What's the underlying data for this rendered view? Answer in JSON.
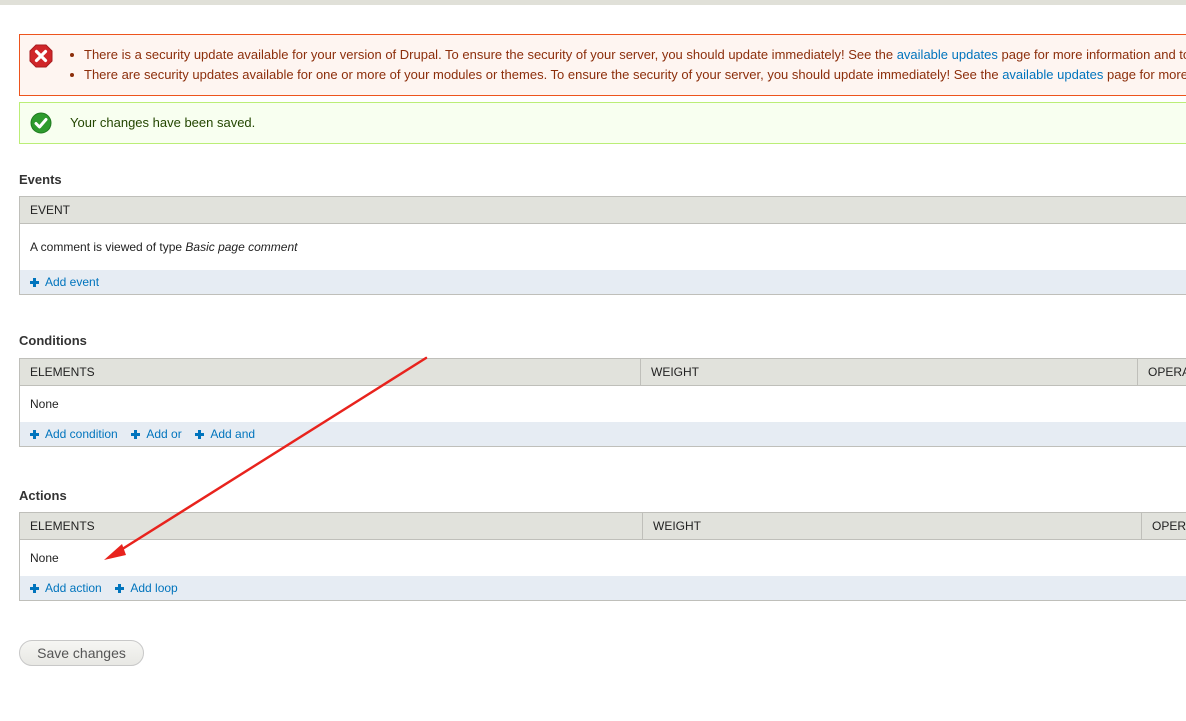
{
  "messages": {
    "error": {
      "items": [
        {
          "before": "There is a security update available for your version of Drupal. To ensure the security of your server, you should update immediately! See the ",
          "link": "available updates",
          "after": " page for more information and to"
        },
        {
          "before": "There are security updates available for one or more of your modules or themes. To ensure the security of your server, you should update immediately! See the ",
          "link": "available updates",
          "after": " page for more"
        }
      ]
    },
    "status": {
      "text": "Your changes have been saved."
    }
  },
  "events": {
    "title": "Events",
    "header": "EVENT",
    "row": {
      "text": "A comment is viewed of type ",
      "emphasis": "Basic page comment"
    },
    "links": [
      "Add event"
    ]
  },
  "conditions": {
    "title": "Conditions",
    "headers": [
      "ELEMENTS",
      "WEIGHT",
      "OPERA"
    ],
    "row": "None",
    "links": [
      "Add condition",
      "Add or",
      "Add and"
    ]
  },
  "actions": {
    "title": "Actions",
    "headers": [
      "ELEMENTS",
      "WEIGHT",
      "OPER"
    ],
    "row": "None",
    "links": [
      "Add action",
      "Add loop"
    ]
  },
  "form": {
    "save_label": "Save changes"
  },
  "colors": {
    "error_border": "#ed541d",
    "error_bg": "#fef5f1",
    "status_border": "#bbee77",
    "status_bg": "#f8fff0",
    "link": "#0074bd",
    "annotation_arrow": "#e8231d"
  }
}
